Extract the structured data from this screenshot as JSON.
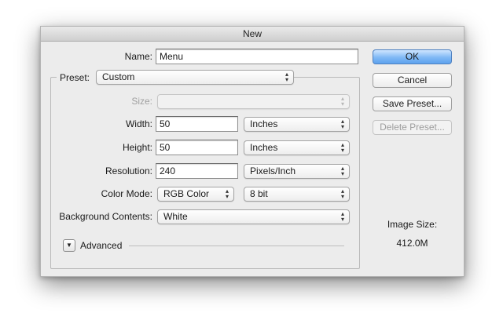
{
  "dialog": {
    "title": "New"
  },
  "name": {
    "label": "Name:",
    "value": "Menu"
  },
  "preset": {
    "label": "Preset:",
    "value": "Custom"
  },
  "size": {
    "label": "Size:",
    "value": ""
  },
  "width": {
    "label": "Width:",
    "value": "50",
    "unit": "Inches"
  },
  "height": {
    "label": "Height:",
    "value": "50",
    "unit": "Inches"
  },
  "resolution": {
    "label": "Resolution:",
    "value": "240",
    "unit": "Pixels/Inch"
  },
  "color_mode": {
    "label": "Color Mode:",
    "mode": "RGB Color",
    "depth": "8 bit"
  },
  "background": {
    "label": "Background Contents:",
    "value": "White"
  },
  "advanced": {
    "label": "Advanced",
    "icon": "disclosure-triangle-icon"
  },
  "buttons": {
    "ok": "OK",
    "cancel": "Cancel",
    "save_preset": "Save Preset...",
    "delete_preset": "Delete Preset..."
  },
  "image_size": {
    "label": "Image Size:",
    "value": "412.0M"
  },
  "colors": {
    "accent": "#5da2ee",
    "dialog_bg": "#ececec"
  }
}
